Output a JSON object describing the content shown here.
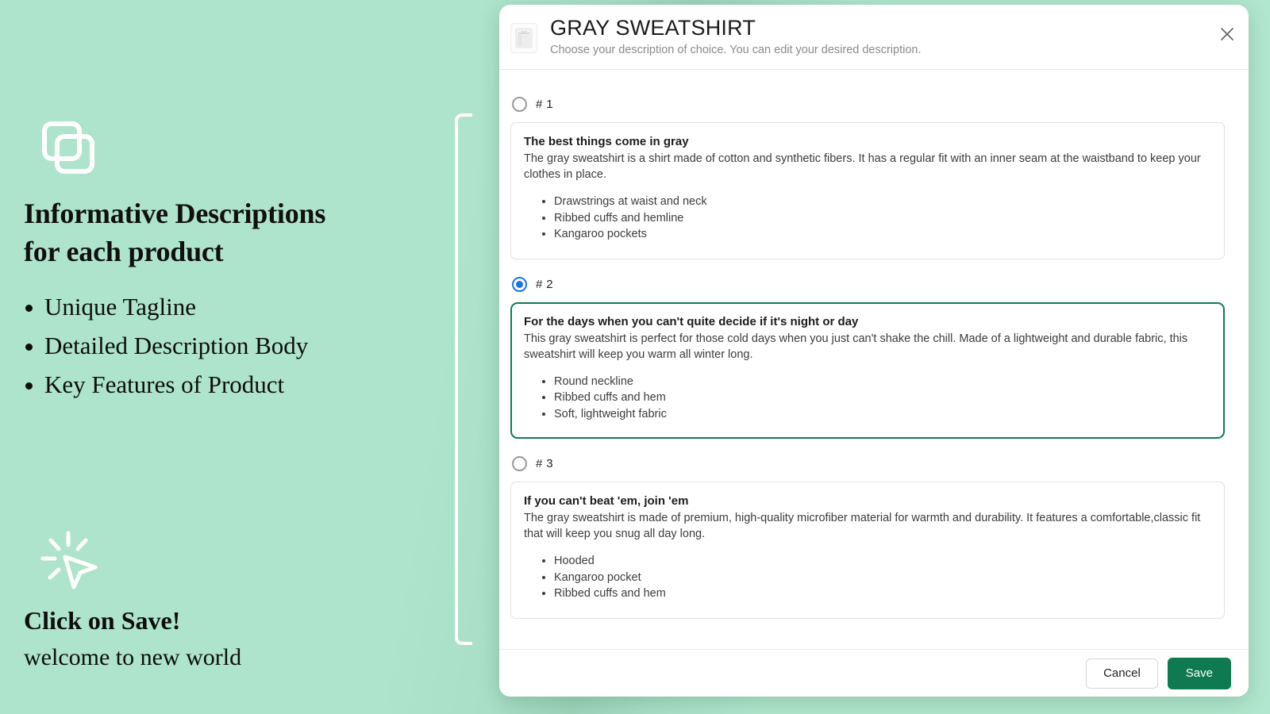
{
  "promo": {
    "icon": "copy-stacked-squares-icon",
    "heading_line1": "Informative Descriptions",
    "heading_line2": "for each product",
    "bullets": [
      "Unique Tagline",
      "Detailed Description Body",
      "Key Features of Product"
    ],
    "cursor_icon": "click-cursor-icon",
    "cta_heading": "Click on Save!",
    "cta_sub": "welcome to new world"
  },
  "modal": {
    "title": "GRAY SWEATSHIRT",
    "subtitle": "Choose your description of choice. You can edit your desired description.",
    "thumbnail_icon": "gray-sweatshirt-thumbnail",
    "close_icon": "close-icon",
    "options": [
      {
        "label": "# 1",
        "selected": false,
        "title": "The best things come in gray",
        "body": "The gray sweatshirt is a shirt made of cotton and synthetic fibers. It has a regular fit with an inner seam at the waistband to keep your clothes in place.",
        "features": [
          "Drawstrings at waist and neck",
          "Ribbed cuffs and hemline",
          "Kangaroo pockets"
        ]
      },
      {
        "label": "# 2",
        "selected": true,
        "title": "For the days when you can't quite decide if it's night or day",
        "body": "This gray sweatshirt is perfect for those cold days when you just can't shake the chill. Made of a lightweight and durable fabric, this sweatshirt will keep you warm all winter long.",
        "features": [
          "Round neckline",
          "Ribbed cuffs and hem",
          "Soft, lightweight fabric"
        ]
      },
      {
        "label": "# 3",
        "selected": false,
        "title": "If you can't beat 'em, join 'em",
        "body": "The gray sweatshirt is made of premium, high-quality microfiber material for warmth and durability. It features a comfortable,classic fit that will keep you snug all day long.",
        "features": [
          "Hooded",
          "Kangaroo pocket",
          "Ribbed cuffs and hem"
        ]
      }
    ],
    "footer": {
      "cancel_label": "Cancel",
      "save_label": "Save"
    }
  },
  "colors": {
    "background": "#ade4cb",
    "save_green": "#0f7a51",
    "selected_border": "#0f7a54",
    "radio_blue": "#1a73e8"
  }
}
